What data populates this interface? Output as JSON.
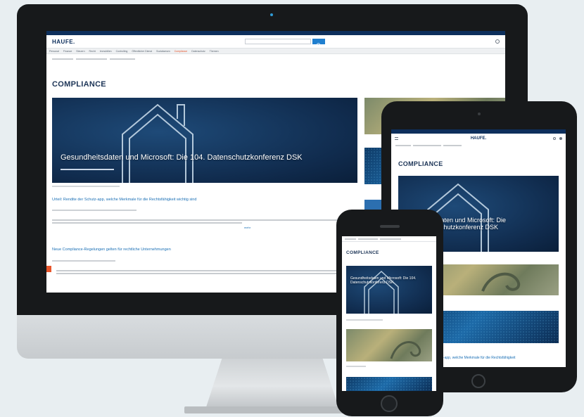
{
  "desktop": {
    "logo": "HAUFE.",
    "nav_items": [
      "Personal",
      "Finance",
      "Steuern",
      "Recht",
      "Immobilien",
      "Controlling",
      "Öffentlicher Dienst",
      "Sozialwesen",
      "Compliance",
      "Datenschutz",
      "Themen"
    ],
    "page_title": "COMPLIANCE",
    "hero": {
      "title": "Gesundheitsdaten und Microsoft: Die 104. Datenschutzkonferenz DSK"
    },
    "article1": {
      "headline": "Urteil: Rendite der Schutz-app, welche Merkmale für die Rechtsfähigkeit wichtig sind",
      "more_label": "mehr"
    },
    "article2": {
      "headline": "Neue Compliance-Regelungen gelten für rechtliche Unternehmungen"
    }
  },
  "tablet": {
    "logo": "HAUFE.",
    "page_title": "COMPLIANCE",
    "hero_title": "...daten und Microsoft: Die ...schutzkonferenz DSK",
    "card2_text": "...",
    "bottom_headline": "...tzel-app, welche Merkmale für die Rechtsfähigkeit"
  },
  "phone": {
    "page_title": "COMPLIANCE",
    "hero_title": "Gesundheitsdaten und Microsoft: Die 104. Datenschutzkonferenz DSK"
  },
  "colors": {
    "navy": "#0d2f5c",
    "accent_blue": "#1a6fb5",
    "search_button": "#1f7fcf",
    "compliance_nav": "#e8552b",
    "frame_black": "#17191b"
  }
}
